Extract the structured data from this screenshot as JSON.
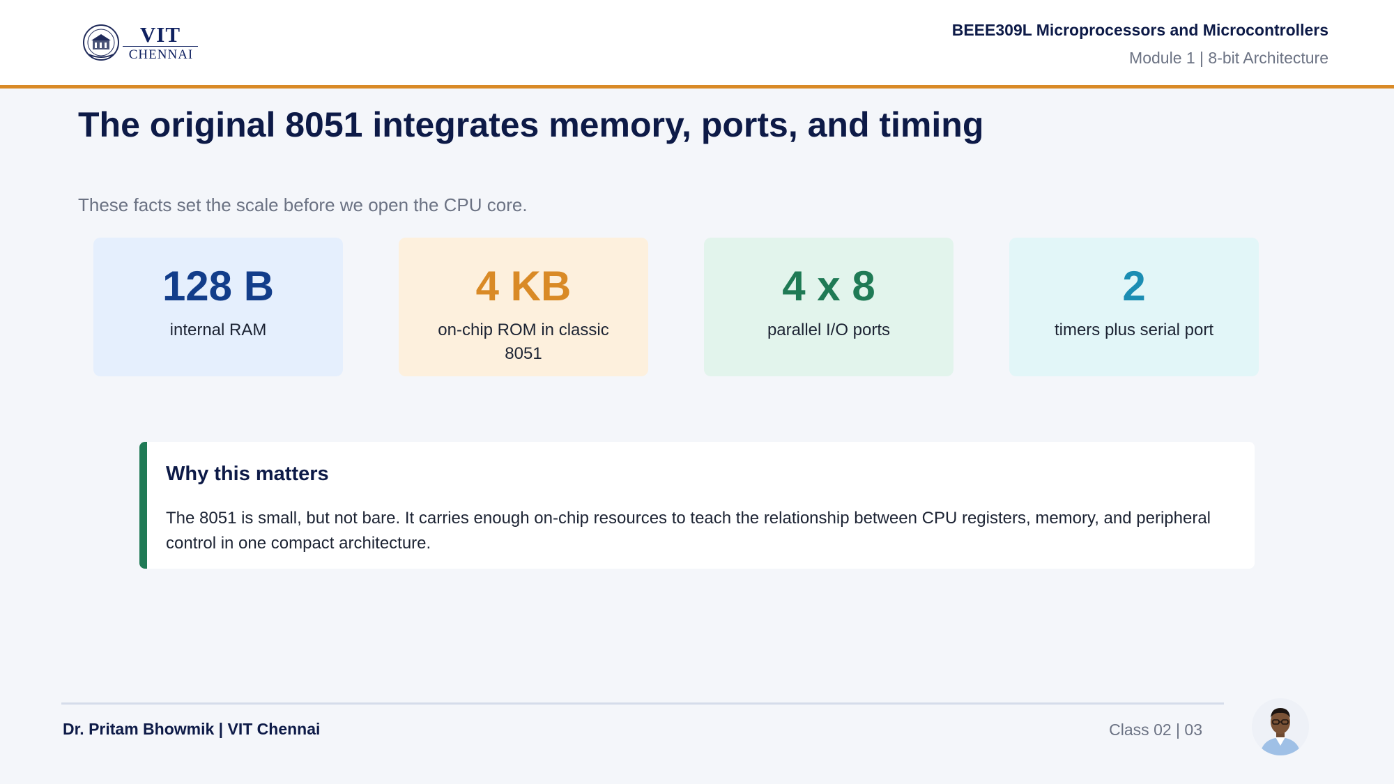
{
  "header": {
    "logo": {
      "name": "VIT",
      "campus": "CHENNAI",
      "icon": "vit-seal-icon"
    },
    "course_title": "BEEE309L Microprocessors and Microcontrollers",
    "module": "Module 1 | 8-bit Architecture"
  },
  "slide": {
    "title": "The original 8051 integrates memory, ports, and timing",
    "subtitle": "These facts set the scale before we open the CPU core."
  },
  "stats": [
    {
      "value": "128 B",
      "label": "internal RAM",
      "accent": "#123d8a",
      "bg": "#e5effd"
    },
    {
      "value": "4 KB",
      "label": "on-chip ROM in classic 8051",
      "accent": "#d98a26",
      "bg": "#fdf0dd"
    },
    {
      "value": "4 x 8",
      "label": "parallel I/O ports",
      "accent": "#1f7a55",
      "bg": "#e2f4ec"
    },
    {
      "value": "2",
      "label": "timers plus serial port",
      "accent": "#1b8db3",
      "bg": "#e2f6f8"
    }
  ],
  "callout": {
    "title": "Why this matters",
    "body": "The 8051 is small, but not bare. It carries enough on-chip resources to teach the relationship between CPU registers, memory, and peripheral control in one compact architecture.",
    "accent": "#1f7a55"
  },
  "footer": {
    "author": "Dr. Pritam Bhowmik | VIT Chennai",
    "class_page": "Class 02  |  03",
    "avatar_icon": "presenter-avatar-icon"
  },
  "colors": {
    "header_accent": "#d98a26",
    "title": "#0d1a47",
    "muted": "#6b7283",
    "background": "#f4f6fa"
  }
}
